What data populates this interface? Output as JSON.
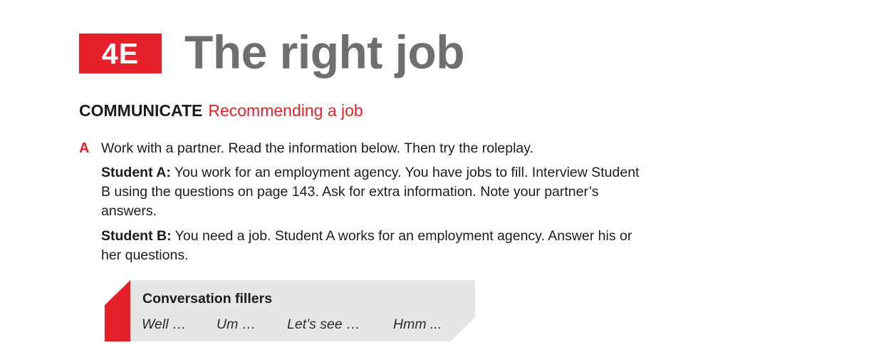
{
  "header": {
    "unit_code": "4E",
    "unit_title": "The right job"
  },
  "section": {
    "label": "COMMUNICATE",
    "subtitle": "Recommending a job"
  },
  "task": {
    "letter": "A",
    "instruction": "Work with a partner. Read the information below. Then try the roleplay."
  },
  "roles": [
    {
      "label": "Student A:",
      "text": " You work for an employment agency. You have jobs to fill. Interview Student B using the questions on page 143. Ask for extra information. Note your partner’s answers."
    },
    {
      "label": "Student B:",
      "text": " You need a job. Student A works for an employment agency. Answer his or her questions."
    }
  ],
  "fillers": {
    "title": "Conversation fillers",
    "items": [
      "Well …",
      "Um …",
      "Let’s see …",
      "Hmm ..."
    ]
  },
  "colors": {
    "accent": "#e5202a",
    "title_gray": "#6f6f6f",
    "panel_gray": "#e6e6e6"
  }
}
